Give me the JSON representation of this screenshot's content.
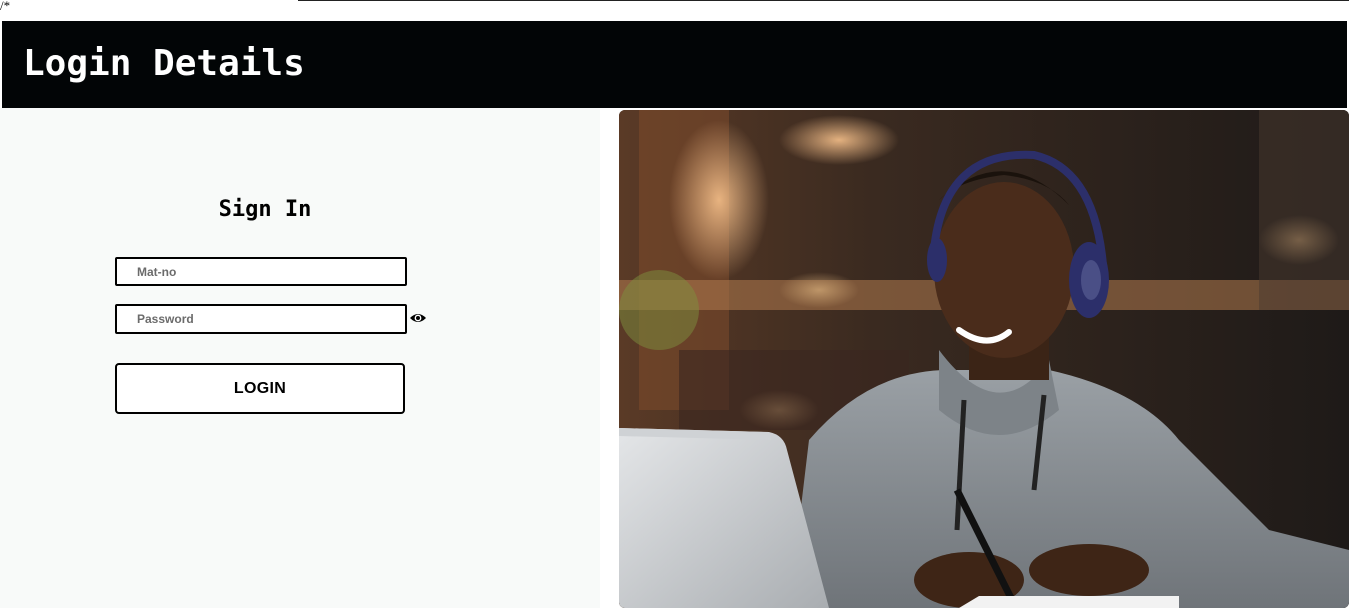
{
  "stray_text": "/*",
  "header": {
    "title": "Login Details"
  },
  "signin": {
    "title": "Sign In",
    "mat_no_placeholder": "Mat-no",
    "password_placeholder": "Password",
    "login_label": "LOGIN"
  },
  "icons": {
    "password_toggle": "eye-icon"
  },
  "colors": {
    "header_bg": "#020506",
    "panel_bg": "#f8faf9",
    "text": "#000000"
  }
}
